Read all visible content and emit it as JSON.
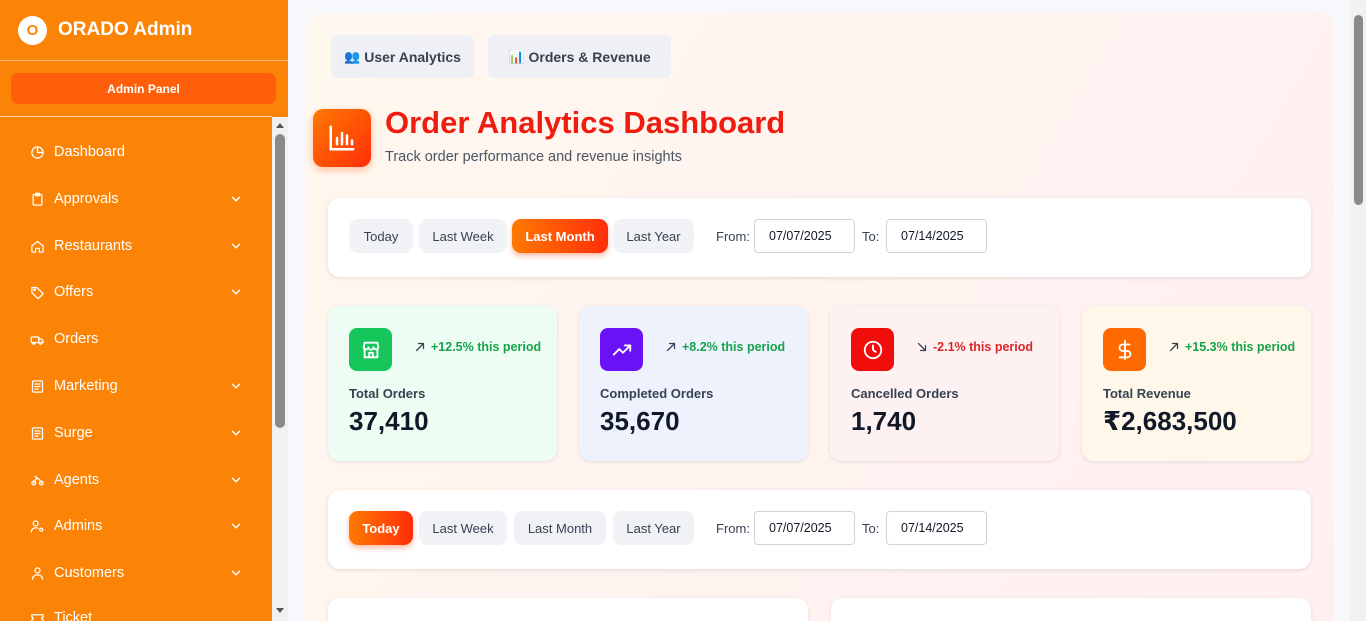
{
  "brand": {
    "logo_letter": "O",
    "title": "ORADO Admin"
  },
  "sidebar": {
    "panel_label": "Admin Panel",
    "items": [
      {
        "label": "Dashboard",
        "icon": "pie-chart-icon",
        "expandable": false
      },
      {
        "label": "Approvals",
        "icon": "clipboard-icon",
        "expandable": true
      },
      {
        "label": "Restaurants",
        "icon": "home-icon",
        "expandable": true
      },
      {
        "label": "Offers",
        "icon": "tag-icon",
        "expandable": true
      },
      {
        "label": "Orders",
        "icon": "truck-icon",
        "expandable": false
      },
      {
        "label": "Marketing",
        "icon": "list-icon",
        "expandable": true
      },
      {
        "label": "Surge",
        "icon": "list-icon",
        "expandable": true
      },
      {
        "label": "Agents",
        "icon": "bike-icon",
        "expandable": true
      },
      {
        "label": "Admins",
        "icon": "user-cog-icon",
        "expandable": true
      },
      {
        "label": "Customers",
        "icon": "user-icon",
        "expandable": true
      },
      {
        "label": "Ticket",
        "icon": "ticket-icon",
        "expandable": false
      }
    ]
  },
  "tabs": [
    {
      "icon": "👥",
      "label": "User Analytics"
    },
    {
      "icon": "📊",
      "label": "Orders & Revenue"
    }
  ],
  "header": {
    "title": "Order Analytics Dashboard",
    "subtitle": "Track order performance and revenue insights"
  },
  "filters_top": {
    "buttons": [
      "Today",
      "Last Week",
      "Last Month",
      "Last Year"
    ],
    "active": "Last Month",
    "from_label": "From:",
    "from_value": "07/07/2025",
    "to_label": "To:",
    "to_value": "07/14/2025"
  },
  "filters_bottom": {
    "buttons": [
      "Today",
      "Last Week",
      "Last Month",
      "Last Year"
    ],
    "active": "Today",
    "from_label": "From:",
    "from_value": "07/07/2025",
    "to_label": "To:",
    "to_value": "07/14/2025"
  },
  "stats": [
    {
      "label": "Total Orders",
      "value": "37,410",
      "trend": "+12.5% this period",
      "direction": "up",
      "icon": "store-icon",
      "icon_color": "#16c65a",
      "bg": "#edfdf3",
      "trend_color": "#16a34a"
    },
    {
      "label": "Completed Orders",
      "value": "35,670",
      "trend": "+8.2% this period",
      "direction": "up",
      "icon": "trending-up-icon",
      "icon_color": "#6a12f5",
      "bg": "#eef2fd",
      "trend_color": "#16a34a"
    },
    {
      "label": "Cancelled Orders",
      "value": "1,740",
      "trend": "-2.1% this period",
      "direction": "down",
      "icon": "clock-icon",
      "icon_color": "#f20d0d",
      "bg": "#fef1f2",
      "trend_color": "#dc2626"
    },
    {
      "label": "Total Revenue",
      "value": "₹2,683,500",
      "trend": "+15.3% this period",
      "direction": "up",
      "icon": "dollar-icon",
      "icon_color": "#ff6a00",
      "bg": "#fff8ea",
      "trend_color": "#16a34a"
    }
  ]
}
